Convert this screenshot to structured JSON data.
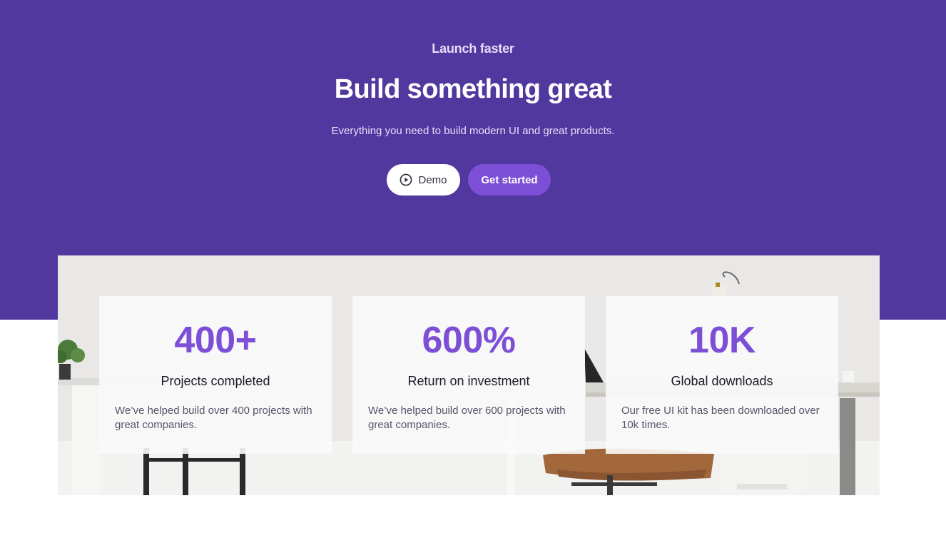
{
  "hero": {
    "eyebrow": "Launch faster",
    "headline": "Build something great",
    "subtitle": "Everything you need to build modern UI and great products.",
    "demo_label": "Demo",
    "get_started_label": "Get started"
  },
  "stats": [
    {
      "value": "400+",
      "title": "Projects completed",
      "description": "We’ve helped build over 400 projects with great companies."
    },
    {
      "value": "600%",
      "title": "Return on investment",
      "description": "We’ve helped build over 600 projects with great companies."
    },
    {
      "value": "10K",
      "title": "Global downloads",
      "description": "Our free UI kit has been downloaded over 10k times."
    }
  ],
  "colors": {
    "hero_bg": "#51389e",
    "accent": "#7c4fd6",
    "demo_bg": "#ffffff"
  },
  "icons": {
    "demo": "play-circle-icon"
  }
}
